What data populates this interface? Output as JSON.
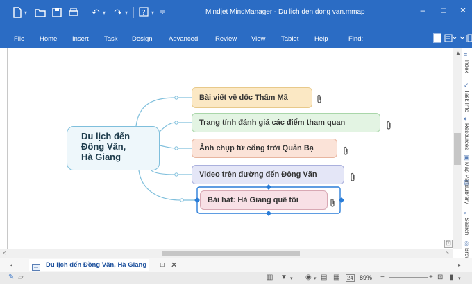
{
  "window": {
    "title": "Mindjet MindManager - Du lich den dong van.mmap",
    "controls": {
      "minimize": "–",
      "maximize": "□",
      "close": "✕"
    }
  },
  "quick_access": {
    "icons": [
      "new-doc-icon",
      "open-icon",
      "save-icon",
      "print-icon",
      "undo-icon",
      "redo-icon",
      "help-icon",
      "customize-icon"
    ]
  },
  "menu": {
    "items": [
      "File",
      "Home",
      "Insert",
      "Task",
      "Design",
      "Advanced",
      "Review",
      "View",
      "Tablet",
      "Help",
      "Find:"
    ]
  },
  "mindmap": {
    "central": {
      "lines": [
        "Du lịch đến",
        "Đồng Văn,",
        "Hà Giang"
      ]
    },
    "topics": [
      {
        "label": "Bài viết về dốc Thẩm Mã",
        "color": "#fbe8c4",
        "border": "#e8c98a"
      },
      {
        "label": "Trang tính đánh giá các điểm tham quan",
        "color": "#e3f4e3",
        "border": "#a9d6a9"
      },
      {
        "label": "Ảnh chụp từ cổng trời Quản Bạ",
        "color": "#fbe3d8",
        "border": "#e8b59f"
      },
      {
        "label": "Video trên đường đến Đông Văn",
        "color": "#e4e6f7",
        "border": "#aab0dd"
      },
      {
        "label": "Bài hát: Hà Giang quê tôi",
        "color": "#f8e0e6",
        "border": "#d8a8b4",
        "selected": true
      }
    ],
    "attachment_icon": "paperclip-icon"
  },
  "side_panel": {
    "tabs": [
      "Index",
      "Task Info",
      "Resources",
      "Map Parts",
      "Library",
      "Search",
      "Browser"
    ]
  },
  "document_tab": {
    "label": "Du lịch đến Đồng Văn, Hà Giang",
    "close": "✕",
    "pin": "⊡"
  },
  "status": {
    "zoom": "89%",
    "zoom_minus": "−",
    "zoom_plus": "+"
  }
}
